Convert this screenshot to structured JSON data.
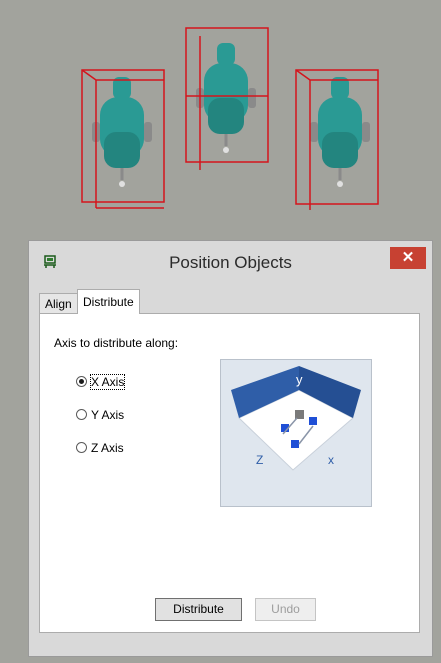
{
  "window": {
    "title": "Position Objects",
    "close_glyph": "✕",
    "icon": "position-tool-icon",
    "accent_close": "#c74132"
  },
  "tabs": [
    {
      "label": "Align",
      "active": false
    },
    {
      "label": "Distribute",
      "active": true
    }
  ],
  "panel": {
    "heading": "Axis to distribute along:",
    "options": [
      {
        "label": "X Axis",
        "checked": true
      },
      {
        "label": "Y Axis",
        "checked": false
      },
      {
        "label": "Z Axis",
        "checked": false
      }
    ],
    "preview_labels": {
      "y": "y",
      "z": "Z",
      "x": "x"
    }
  },
  "buttons": {
    "distribute": "Distribute",
    "undo": "Undo"
  },
  "colors": {
    "viewport_bg": "#a2a39d",
    "chair": "#2a9a94",
    "bbox": "#d4141c",
    "preview_wall": "#2f5ea8"
  }
}
